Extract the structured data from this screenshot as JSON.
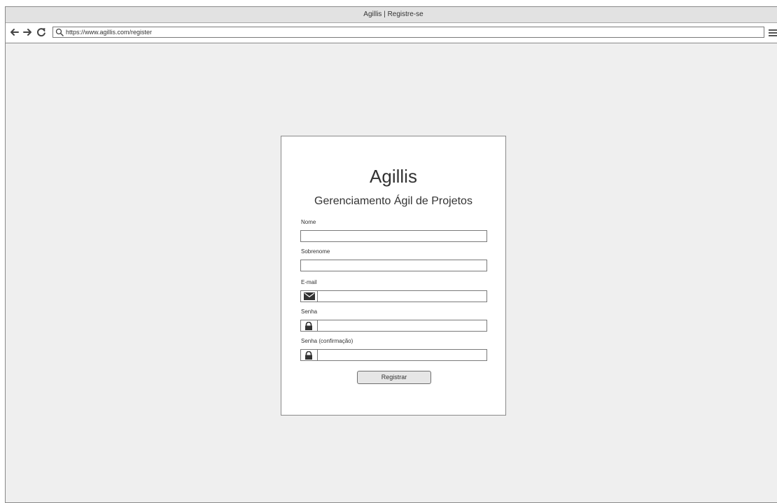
{
  "window": {
    "title": "Agillis | Registre-se"
  },
  "toolbar": {
    "back_icon": "arrow-left-icon",
    "forward_icon": "arrow-right-icon",
    "reload_icon": "reload-icon",
    "search_icon": "search-icon",
    "url": "https://www.agillis.com/register",
    "menu_icon": "hamburger-menu-icon"
  },
  "form": {
    "brand": "Agillis",
    "subtitle": "Gerenciamento Ágil de Projetos",
    "fields": [
      {
        "label": "Nome",
        "value": "",
        "icon": null
      },
      {
        "label": "Sobrenome",
        "value": "",
        "icon": null
      },
      {
        "label": "E-mail",
        "value": "",
        "icon": "envelope-icon"
      },
      {
        "label": "Senha",
        "value": "",
        "icon": "lock-icon"
      },
      {
        "label": "Senha (confirmação)",
        "value": "",
        "icon": "lock-icon"
      }
    ],
    "submit_label": "Registrar"
  },
  "colors": {
    "window_background": "#efefef",
    "card_background": "#ffffff",
    "border": "#8a8a8a",
    "text": "#333333"
  }
}
